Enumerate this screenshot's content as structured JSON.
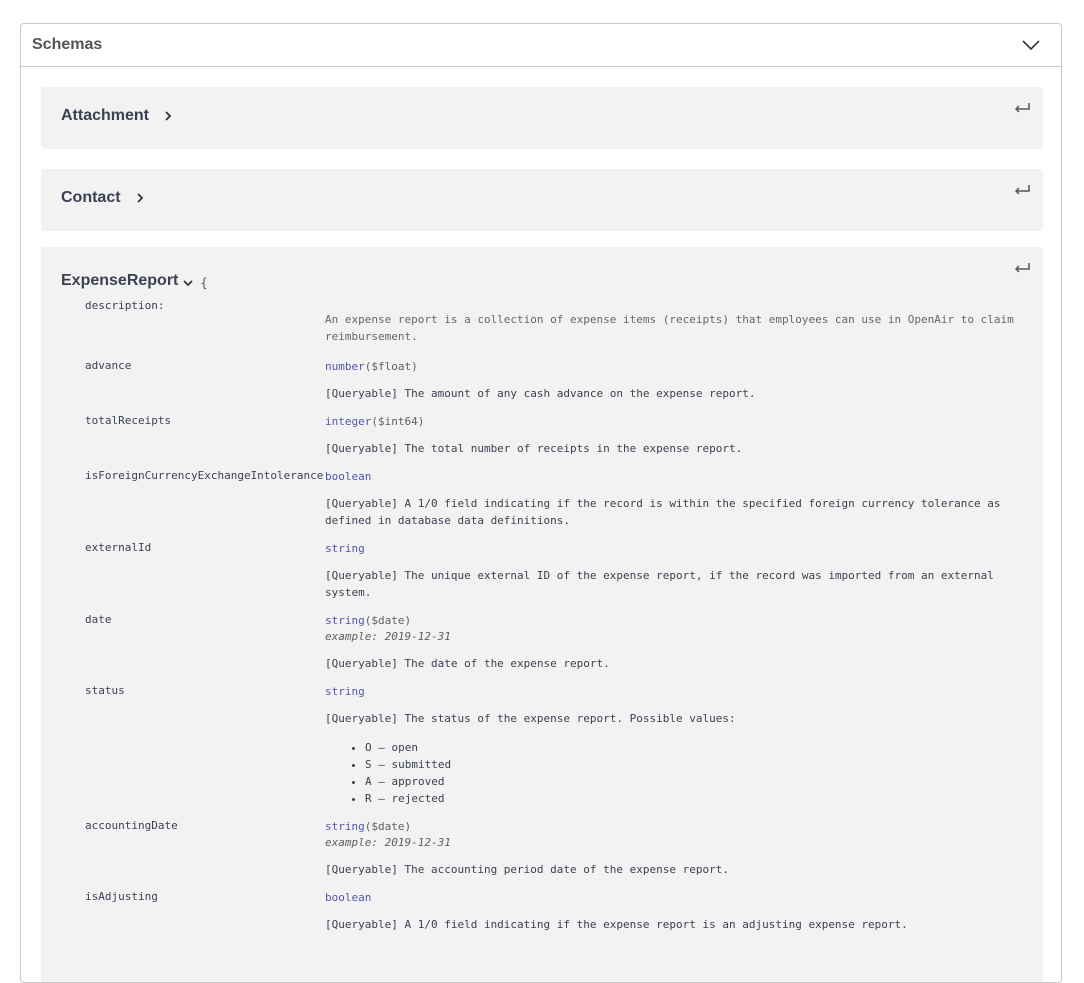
{
  "section": {
    "title": "Schemas"
  },
  "models": [
    {
      "name": "Attachment"
    },
    {
      "name": "Contact"
    }
  ],
  "expense_report": {
    "name": "ExpenseReport",
    "brace": "{",
    "description_label": "description:",
    "description": "An expense report is a collection of expense items (receipts) that employees can use in OpenAir to claim reimbursement.",
    "properties": [
      {
        "name": "advance",
        "type": "number",
        "format": "($float)",
        "desc": "[Queryable] The amount of any cash advance on the expense report."
      },
      {
        "name": "totalReceipts",
        "type": "integer",
        "format": "($int64)",
        "desc": "[Queryable] The total number of receipts in the expense report."
      },
      {
        "name": "isForeignCurrencyExchangeIntolerance",
        "type": "boolean",
        "desc": "[Queryable] A 1/0 field indicating if the record is within the specified foreign currency tolerance as defined in database data definitions."
      },
      {
        "name": "externalId",
        "type": "string",
        "desc": "[Queryable] The unique external ID of the expense report, if the record was imported from an external system."
      },
      {
        "name": "date",
        "type": "string",
        "format": "($date)",
        "example": "example: 2019-12-31",
        "desc": "[Queryable] The date of the expense report."
      },
      {
        "name": "status",
        "type": "string",
        "desc": "[Queryable] The status of the expense report. Possible values:",
        "list": [
          "O – open",
          "S – submitted",
          "A – approved",
          "R – rejected"
        ]
      },
      {
        "name": "accountingDate",
        "type": "string",
        "format": "($date)",
        "example": "example: 2019-12-31",
        "desc": "[Queryable] The accounting period date of the expense report."
      },
      {
        "name": "isAdjusting",
        "type": "boolean",
        "desc": "[Queryable] A 1/0 field indicating if the expense report is an adjusting expense report."
      }
    ]
  }
}
